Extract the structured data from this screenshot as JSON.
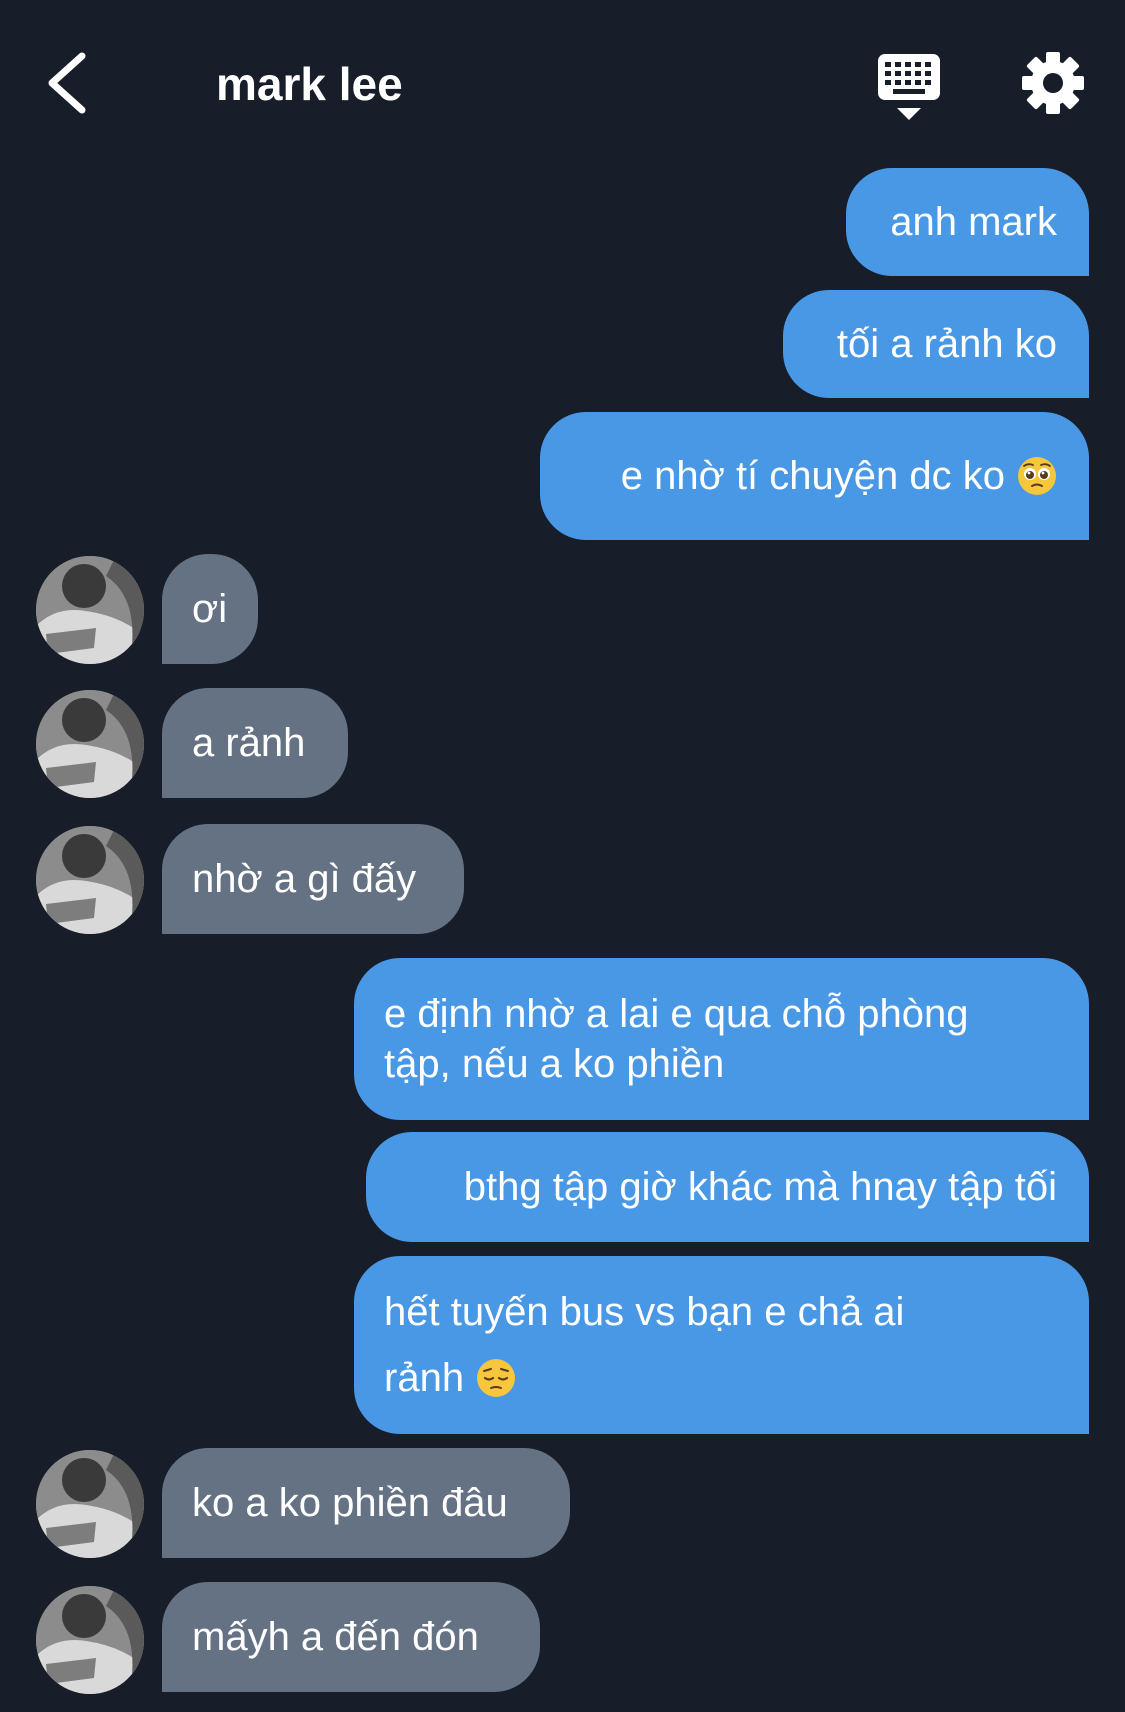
{
  "header": {
    "title": "mark lee",
    "back_icon": "chevron-left-icon",
    "keyboard_icon": "keyboard-icon",
    "settings_icon": "gear-icon"
  },
  "colors": {
    "background": "#171e29",
    "outgoing_bubble": "#4898e6",
    "incoming_bubble": "#657283",
    "text": "#ffffff"
  },
  "messages": [
    {
      "side": "out",
      "text": "anh mark"
    },
    {
      "side": "out",
      "text": "tối a rảnh ko"
    },
    {
      "side": "out",
      "text": "e nhờ tí chuyện dc ko",
      "emoji": "pleading-face-emoji"
    },
    {
      "side": "in",
      "text": "ơi"
    },
    {
      "side": "in",
      "text": "a rảnh"
    },
    {
      "side": "in",
      "text": "nhờ a gì đấy"
    },
    {
      "side": "out",
      "lines": [
        "e định nhờ a lai e qua chỗ phòng",
        "tập, nếu a ko phiền"
      ]
    },
    {
      "side": "out",
      "text": "bthg tập giờ khác mà hnay tập tối"
    },
    {
      "side": "out",
      "lines": [
        "hết tuyến bus vs bạn e chả ai",
        "rảnh"
      ],
      "emoji": "pensive-face-emoji"
    },
    {
      "side": "in",
      "text": "ko a ko phiền đâu"
    },
    {
      "side": "in",
      "text": "mấyh a đến đón"
    }
  ]
}
